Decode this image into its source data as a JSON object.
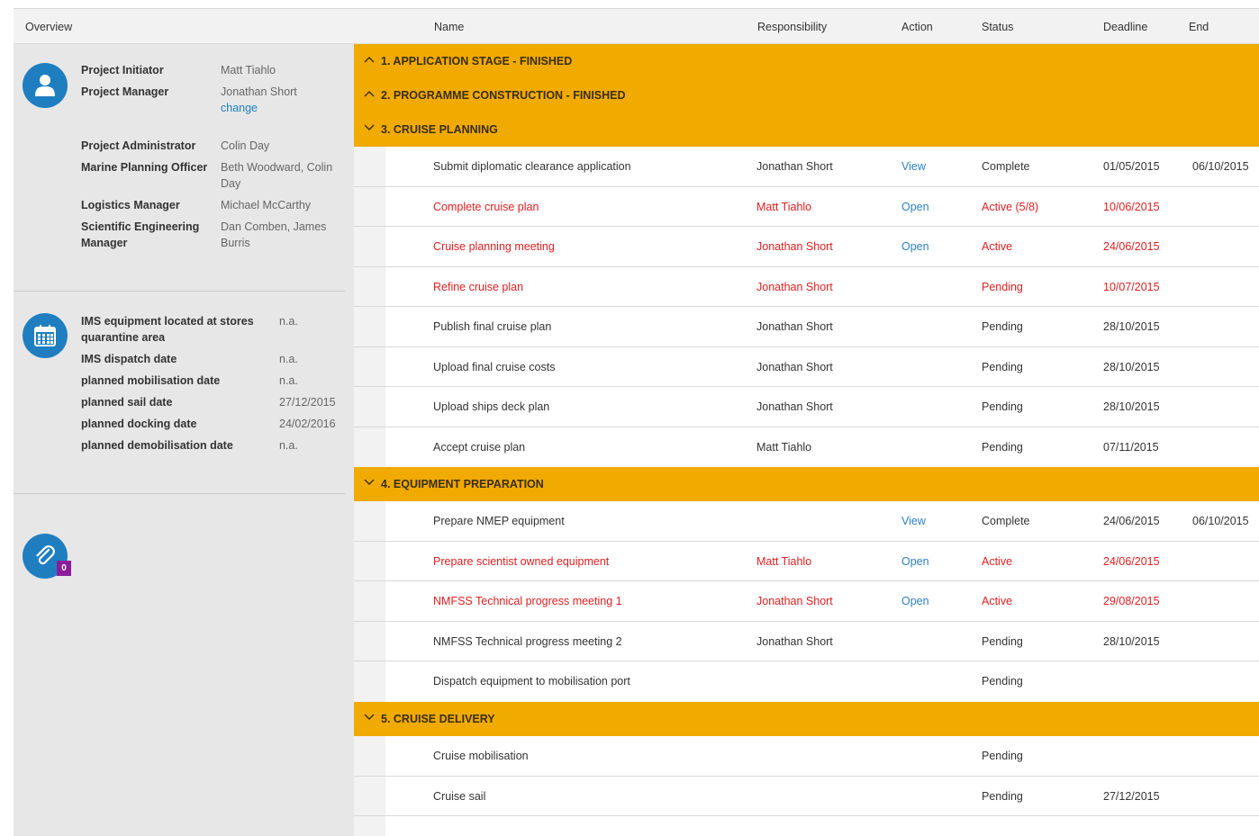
{
  "header": {
    "overview": "Overview",
    "columns": {
      "name": "Name",
      "responsibility": "Responsibility",
      "action": "Action",
      "status": "Status",
      "deadline": "Deadline",
      "end": "End"
    }
  },
  "people": {
    "project_initiator": {
      "label": "Project Initiator",
      "value": "Matt Tiahlo"
    },
    "project_manager": {
      "label": "Project Manager",
      "value": "Jonathan Short",
      "change_link": "change"
    },
    "project_administrator": {
      "label": "Project Administrator",
      "value": "Colin Day"
    },
    "marine_planning_officer": {
      "label": "Marine Planning Officer",
      "value_line1": "Beth Woodward, Colin",
      "value_line2": "Day"
    },
    "logistics_manager": {
      "label": "Logistics Manager",
      "value": "Michael McCarthy"
    },
    "scientific_engineering_manager": {
      "label_line1": "Scientific Engineering",
      "label_line2": "Manager",
      "value_line1": "Dan Comben, James",
      "value_line2": "Burris"
    }
  },
  "dates": {
    "ims_equipment": {
      "label_line1": "IMS equipment located at stores",
      "label_line2": "quarantine area",
      "value": "n.a."
    },
    "ims_dispatch": {
      "label": "IMS dispatch date",
      "value": "n.a."
    },
    "planned_mobilisation": {
      "label": "planned mobilisation date",
      "value": "n.a."
    },
    "planned_sail": {
      "label": "planned sail date",
      "value": "27/12/2015"
    },
    "planned_docking": {
      "label": "planned docking date",
      "value": "24/02/2016"
    },
    "planned_demobilisation": {
      "label": "planned demobilisation date",
      "value": "n.a."
    }
  },
  "attachments": {
    "count": "0"
  },
  "groups": [
    {
      "title": "1. APPLICATION STAGE - FINISHED",
      "expanded": false
    },
    {
      "title": "2. PROGRAMME CONSTRUCTION - FINISHED",
      "expanded": false
    },
    {
      "title": "3. CRUISE PLANNING",
      "expanded": true
    },
    {
      "title": "4. EQUIPMENT PREPARATION",
      "expanded": true
    },
    {
      "title": "5. CRUISE DELIVERY",
      "expanded": true
    }
  ],
  "tasks": [
    {
      "name": "Submit diplomatic clearance application",
      "responsibility": "Jonathan Short",
      "action": "View",
      "status": "Complete",
      "deadline": "01/05/2015",
      "end": "06/10/2015"
    },
    {
      "name": "Complete cruise plan",
      "responsibility": "Matt Tiahlo",
      "action": "Open",
      "status": "Active (5/8)",
      "deadline": "10/06/2015",
      "end": ""
    },
    {
      "name": "Cruise planning meeting",
      "responsibility": "Jonathan Short",
      "action": "Open",
      "status": "Active",
      "deadline": "24/06/2015",
      "end": ""
    },
    {
      "name": "Refine cruise plan",
      "responsibility": "Jonathan Short",
      "action": "",
      "status": "Pending",
      "deadline": "10/07/2015",
      "end": ""
    },
    {
      "name": "Publish final cruise plan",
      "responsibility": "Jonathan Short",
      "action": "",
      "status": "Pending",
      "deadline": "28/10/2015",
      "end": ""
    },
    {
      "name": "Upload final cruise costs",
      "responsibility": "Jonathan Short",
      "action": "",
      "status": "Pending",
      "deadline": "28/10/2015",
      "end": ""
    },
    {
      "name": "Upload ships deck plan",
      "responsibility": "Jonathan Short",
      "action": "",
      "status": "Pending",
      "deadline": "28/10/2015",
      "end": ""
    },
    {
      "name": "Accept cruise plan",
      "responsibility": "Matt Tiahlo",
      "action": "",
      "status": "Pending",
      "deadline": "07/11/2015",
      "end": ""
    },
    {
      "name": "Prepare NMEP equipment",
      "responsibility": "",
      "action": "View",
      "status": "Complete",
      "deadline": "24/06/2015",
      "end": "06/10/2015"
    },
    {
      "name": "Prepare scientist owned equipment",
      "responsibility": "Matt Tiahlo",
      "action": "Open",
      "status": "Active",
      "deadline": "24/06/2015",
      "end": ""
    },
    {
      "name": "NMFSS Technical progress meeting 1",
      "responsibility": "Jonathan Short",
      "action": "Open",
      "status": "Active",
      "deadline": "29/08/2015",
      "end": ""
    },
    {
      "name": "NMFSS Technical progress meeting 2",
      "responsibility": "Jonathan Short",
      "action": "",
      "status": "Pending",
      "deadline": "28/10/2015",
      "end": ""
    },
    {
      "name": "Dispatch equipment to mobilisation port",
      "responsibility": "",
      "action": "",
      "status": "Pending",
      "deadline": "",
      "end": ""
    },
    {
      "name": "Cruise mobilisation",
      "responsibility": "",
      "action": "",
      "status": "Pending",
      "deadline": "",
      "end": ""
    },
    {
      "name": "Cruise sail",
      "responsibility": "",
      "action": "",
      "status": "Pending",
      "deadline": "27/12/2015",
      "end": ""
    }
  ],
  "colors": {
    "group_bar": "#f0aa00",
    "icon_circle": "#1f7ec0",
    "overdue_text": "#e02020",
    "action_link": "#2a7fc7",
    "attachment_badge": "#8a1e9a"
  }
}
